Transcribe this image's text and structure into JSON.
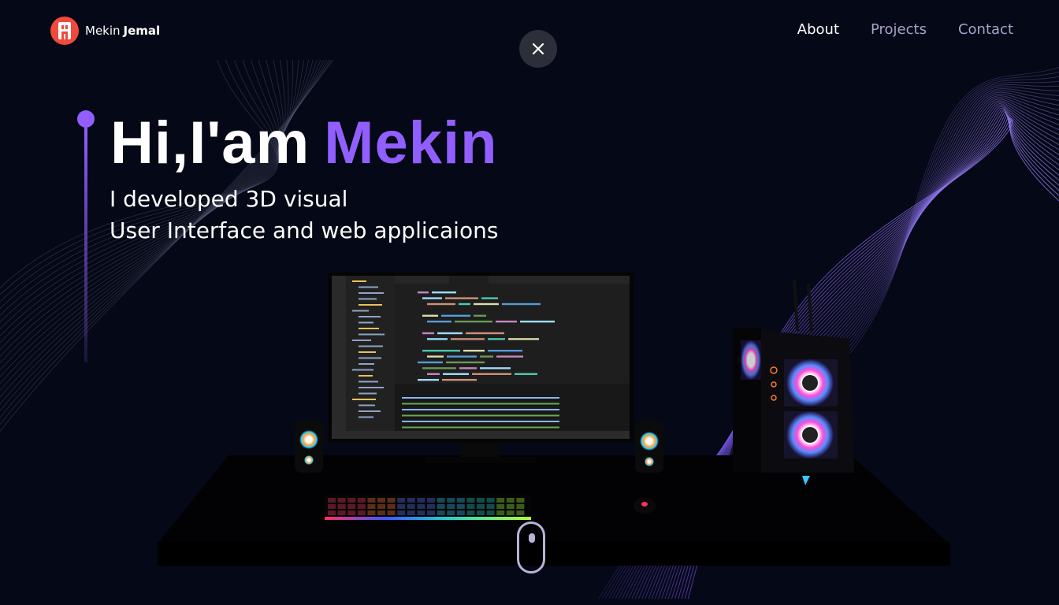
{
  "page": {
    "progress": 0.2
  },
  "nav": {
    "logo": {
      "first": "Mekin",
      "last": "Jemal",
      "icon": "logo-icon"
    },
    "links": [
      {
        "label": "About",
        "active": true
      },
      {
        "label": "Projects",
        "active": false
      },
      {
        "label": "Contact",
        "active": false
      }
    ]
  },
  "close": {
    "icon": "close-icon"
  },
  "hero": {
    "greeting": "Hi,I'am",
    "name": "Mekin",
    "line1": "I developed 3D visual",
    "line2": "User Interface and web applicaions"
  },
  "colors": {
    "background": "#050816",
    "accent": "#915eff",
    "logo": "#f04a3d"
  },
  "scroll": {
    "icon": "mouse-scroll-icon"
  }
}
